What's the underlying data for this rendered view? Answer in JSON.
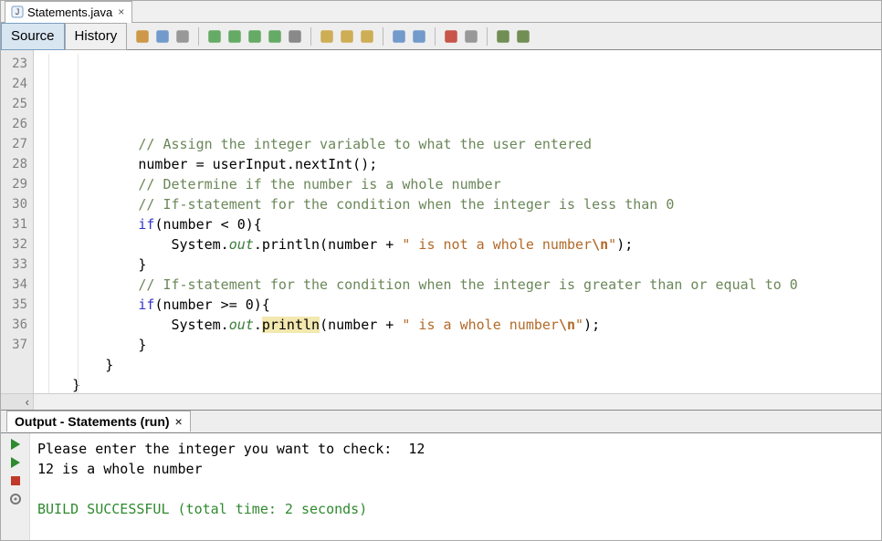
{
  "tab": {
    "filename": "Statements.java",
    "close_glyph": "×"
  },
  "mode": {
    "source": "Source",
    "history": "History",
    "active": "source"
  },
  "toolbar_icons": [
    "refresh-icon",
    "wrap-dropdown-icon",
    "diff-icon",
    "nav-back-icon",
    "nav-fwd-icon",
    "nav-up-icon",
    "nav-down-icon",
    "select-rect-icon",
    "arrow-up-icon",
    "arrow-down-icon",
    "arrow-return-icon",
    "shift-left-icon",
    "shift-right-icon",
    "record-icon",
    "stop-icon",
    "comment-icon",
    "uncomment-icon"
  ],
  "code": {
    "first_line": 23,
    "lines": [
      {
        "n": 23,
        "indent": 12,
        "tokens": [
          {
            "cls": "c-comment",
            "raw": "// Assign the integer variable to what the user entered"
          }
        ]
      },
      {
        "n": 24,
        "indent": 12,
        "tokens": [
          {
            "cls": "c-default",
            "raw": "number = userInput.nextInt();"
          }
        ]
      },
      {
        "n": 25,
        "indent": 0,
        "tokens": [
          {
            "cls": "c-default",
            "raw": ""
          }
        ]
      },
      {
        "n": 26,
        "indent": 12,
        "tokens": [
          {
            "cls": "c-comment",
            "raw": "// Determine if the number is a whole number"
          }
        ]
      },
      {
        "n": 27,
        "indent": 12,
        "tokens": [
          {
            "cls": "c-comment",
            "raw": "// If-statement for the condition when the integer is less than 0"
          }
        ]
      },
      {
        "n": 28,
        "indent": 12,
        "tokens": [
          {
            "cls": "c-kw",
            "raw": "if"
          },
          {
            "cls": "c-default",
            "raw": "(number < 0){"
          }
        ]
      },
      {
        "n": 29,
        "indent": 16,
        "tokens": [
          {
            "cls": "c-default",
            "raw": "System."
          },
          {
            "cls": "c-static",
            "raw": "out"
          },
          {
            "cls": "c-default",
            "raw": ".println(number + "
          },
          {
            "cls": "c-string",
            "raw": "\" is not a whole number"
          },
          {
            "cls": "c-escape",
            "raw": "\\n"
          },
          {
            "cls": "c-string",
            "raw": "\""
          },
          {
            "cls": "c-default",
            "raw": ");"
          }
        ]
      },
      {
        "n": 30,
        "indent": 12,
        "tokens": [
          {
            "cls": "c-default",
            "raw": "}"
          }
        ]
      },
      {
        "n": 31,
        "indent": 0,
        "tokens": [
          {
            "cls": "c-default",
            "raw": ""
          }
        ]
      },
      {
        "n": 32,
        "indent": 12,
        "tokens": [
          {
            "cls": "c-comment",
            "raw": "// If-statement for the condition when the integer is greater than or equal to 0"
          }
        ]
      },
      {
        "n": 33,
        "indent": 12,
        "tokens": [
          {
            "cls": "c-kw",
            "raw": "if"
          },
          {
            "cls": "c-default",
            "raw": "(number >= 0){"
          }
        ]
      },
      {
        "n": 34,
        "indent": 16,
        "tokens": [
          {
            "cls": "c-default",
            "raw": "System."
          },
          {
            "cls": "c-static",
            "raw": "out"
          },
          {
            "cls": "c-default",
            "raw": "."
          },
          {
            "cls": "c-default hl",
            "raw": "println"
          },
          {
            "cls": "c-default",
            "raw": "(number + "
          },
          {
            "cls": "c-string",
            "raw": "\" is a whole number"
          },
          {
            "cls": "c-escape",
            "raw": "\\n"
          },
          {
            "cls": "c-string",
            "raw": "\""
          },
          {
            "cls": "c-default",
            "raw": ");"
          }
        ]
      },
      {
        "n": 35,
        "indent": 12,
        "tokens": [
          {
            "cls": "c-default",
            "raw": "}"
          }
        ]
      },
      {
        "n": 36,
        "indent": 8,
        "tokens": [
          {
            "cls": "c-default",
            "raw": "}"
          }
        ]
      },
      {
        "n": 37,
        "indent": 4,
        "tokens": [
          {
            "cls": "c-default",
            "raw": "}"
          }
        ]
      }
    ]
  },
  "output": {
    "title": "Output - Statements (run)",
    "close_glyph": "×",
    "lines": [
      {
        "cls": "",
        "text": "Please enter the integer you want to check:  12"
      },
      {
        "cls": "",
        "text": "12 is a whole number"
      },
      {
        "cls": "",
        "text": ""
      },
      {
        "cls": "out-green",
        "text": "BUILD SUCCESSFUL (total time: 2 seconds)"
      }
    ],
    "side_icons": [
      "run-again-icon",
      "run-again-alt-icon",
      "stop-run-icon",
      "settings-icon"
    ]
  },
  "colors": {
    "comment": "#6b8759",
    "keyword": "#3333cc",
    "static": "#3b7c3b",
    "string": "#b26a28",
    "highlight_bg": "#f2e8b0",
    "build_ok": "#2f8a2f"
  }
}
